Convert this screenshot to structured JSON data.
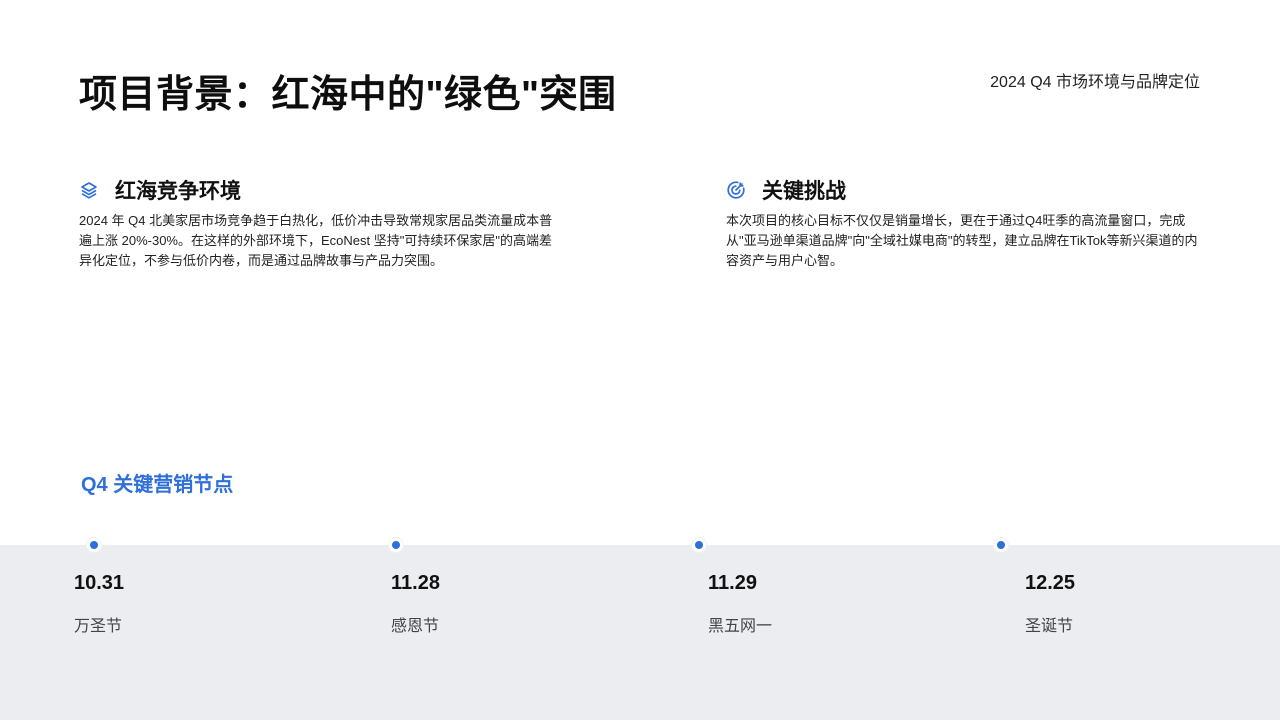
{
  "header": {
    "title": "项目背景：红海中的\"绿色\"突围",
    "subtitle": "2024 Q4 市场环境与品牌定位"
  },
  "sections": [
    {
      "icon": "layers-icon",
      "title": "红海竞争环境",
      "body": "2024 年 Q4 北美家居市场竞争趋于白热化，低价冲击导致常规家居品类流量成本普遍上涨 20%-30%。在这样的外部环境下，EcoNest 坚持\"可持续环保家居\"的高端差异化定位，不参与低价内卷，而是通过品牌故事与产品力突围。"
    },
    {
      "icon": "target-icon",
      "title": "关键挑战",
      "body": "本次项目的核心目标不仅仅是销量增长，更在于通过Q4旺季的高流量窗口，完成从\"亚马逊单渠道品牌\"向\"全域社媒电商\"的转型，建立品牌在TikTok等新兴渠道的内容资产与用户心智。"
    }
  ],
  "timeline": {
    "title": "Q4 关键营销节点",
    "nodes": [
      {
        "date": "10.31",
        "label": "万圣节"
      },
      {
        "date": "11.28",
        "label": "感恩节"
      },
      {
        "date": "11.29",
        "label": "黑五网一"
      },
      {
        "date": "12.25",
        "label": "圣诞节"
      }
    ]
  },
  "colors": {
    "accent": "#2f6fd9",
    "band": "#ebedf0",
    "text": "#111111"
  }
}
